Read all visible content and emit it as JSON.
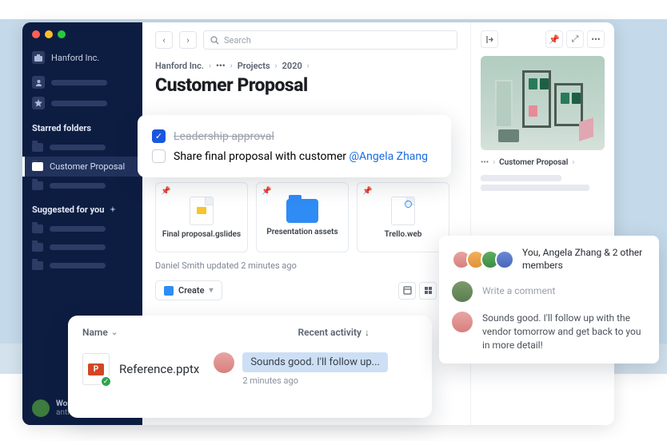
{
  "sidebar": {
    "company": "Hanford Inc.",
    "starred_header": "Starred folders",
    "active_item": "Customer Proposal",
    "suggested_header": "Suggested for you",
    "user_name": "Work",
    "user_sub": "anthon"
  },
  "topbar": {
    "search_placeholder": "Search"
  },
  "breadcrumb": {
    "root": "Hanford Inc.",
    "dots": "•••",
    "projects": "Projects",
    "year": "2020"
  },
  "page_title": "Customer Proposal",
  "tasks": {
    "done": "Leadership approval",
    "todo": "Share final proposal with customer ",
    "mention": "@Angela Zhang"
  },
  "tiles": {
    "slides": "Final proposal.gslides",
    "folder": "Presentation assets",
    "trello": "Trello.web"
  },
  "meta": "Daniel Smith updated 2 minutes ago",
  "create_label": "Create",
  "rpanel": {
    "bc_dots": "•••",
    "bc_label": "Customer Proposal"
  },
  "members": {
    "line": "You, Angela Zhang & 2 other members",
    "write": "Write a comment",
    "comment": "Sounds good. I'll follow up with the vendor tomorrow and get back to you in more detail!"
  },
  "detail": {
    "col_name": "Name",
    "col_activity": "Recent activity",
    "file": "Reference.pptx",
    "bubble": "Sounds good. I'll follow up...",
    "time": "2 minutes ago"
  }
}
